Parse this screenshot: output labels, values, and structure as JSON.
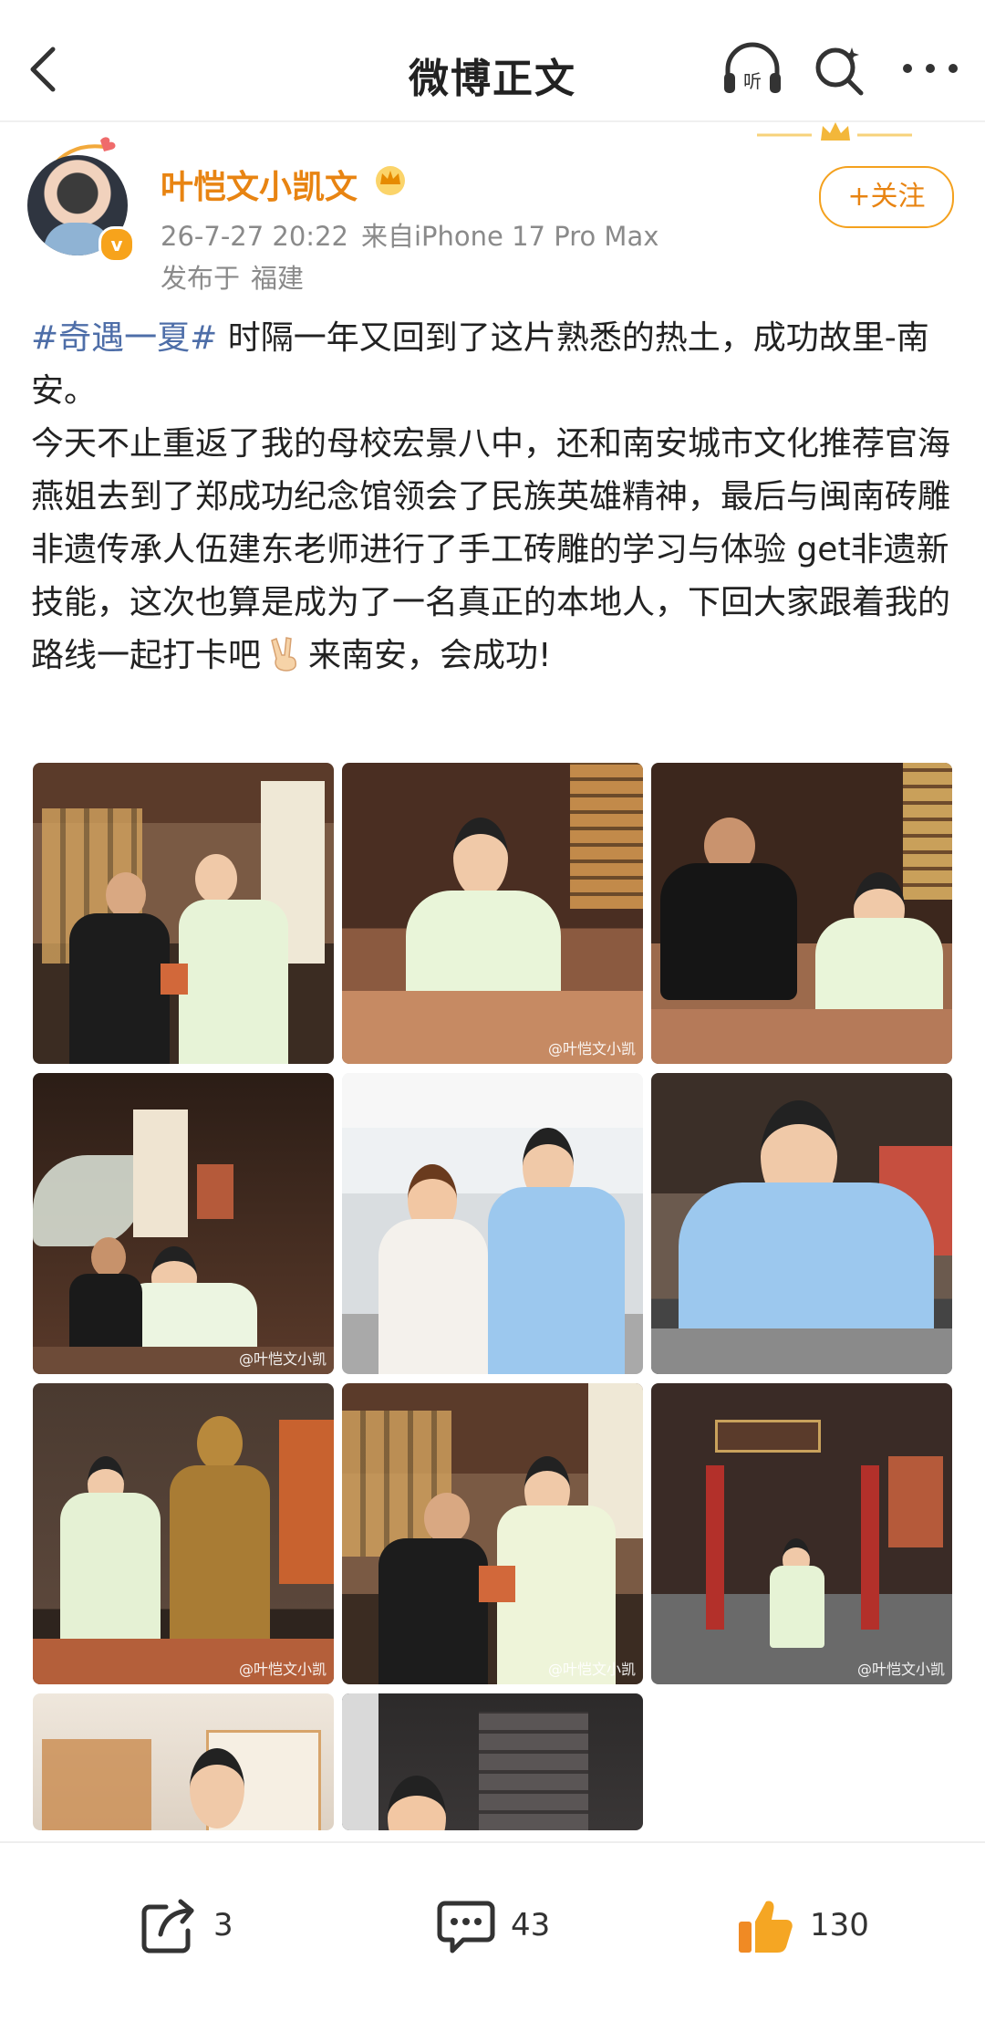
{
  "header": {
    "title": "微博正文"
  },
  "author": {
    "name": "叶恺文小凯文",
    "date": "26-7-27 20:22",
    "source": "来自iPhone 17 Pro Max",
    "location_prefix": "发布于",
    "location": "福建",
    "follow_label": "+关注",
    "verified_mark": "v"
  },
  "post": {
    "topic": "#奇遇一夏#",
    "line1": " 时隔一年又回到了这片熟悉的热土，成功故里-南安。",
    "line2": "今天不止重返了我的母校宏景八中，还和南安城市文化推荐官海燕姐去到了郑成功纪念馆领会了民族英雄精神，最后与闽南砖雕非遗传承人伍建东老师进行了手工砖雕的学习与体验 get非遗新技能，这次也算是成为了一名真正的本地人，下回大家跟着我的路线一起打卡吧",
    "line2_tail": "来南安，会成功!"
  },
  "images": {
    "watermark": "@叶恺文小凯"
  },
  "actions": {
    "repost_count": "3",
    "comment_count": "43",
    "like_count": "130"
  },
  "colors": {
    "username": "#e88412",
    "topic": "#4e6ea8",
    "follow_border": "#f4a11e",
    "like": "#f5a623"
  }
}
